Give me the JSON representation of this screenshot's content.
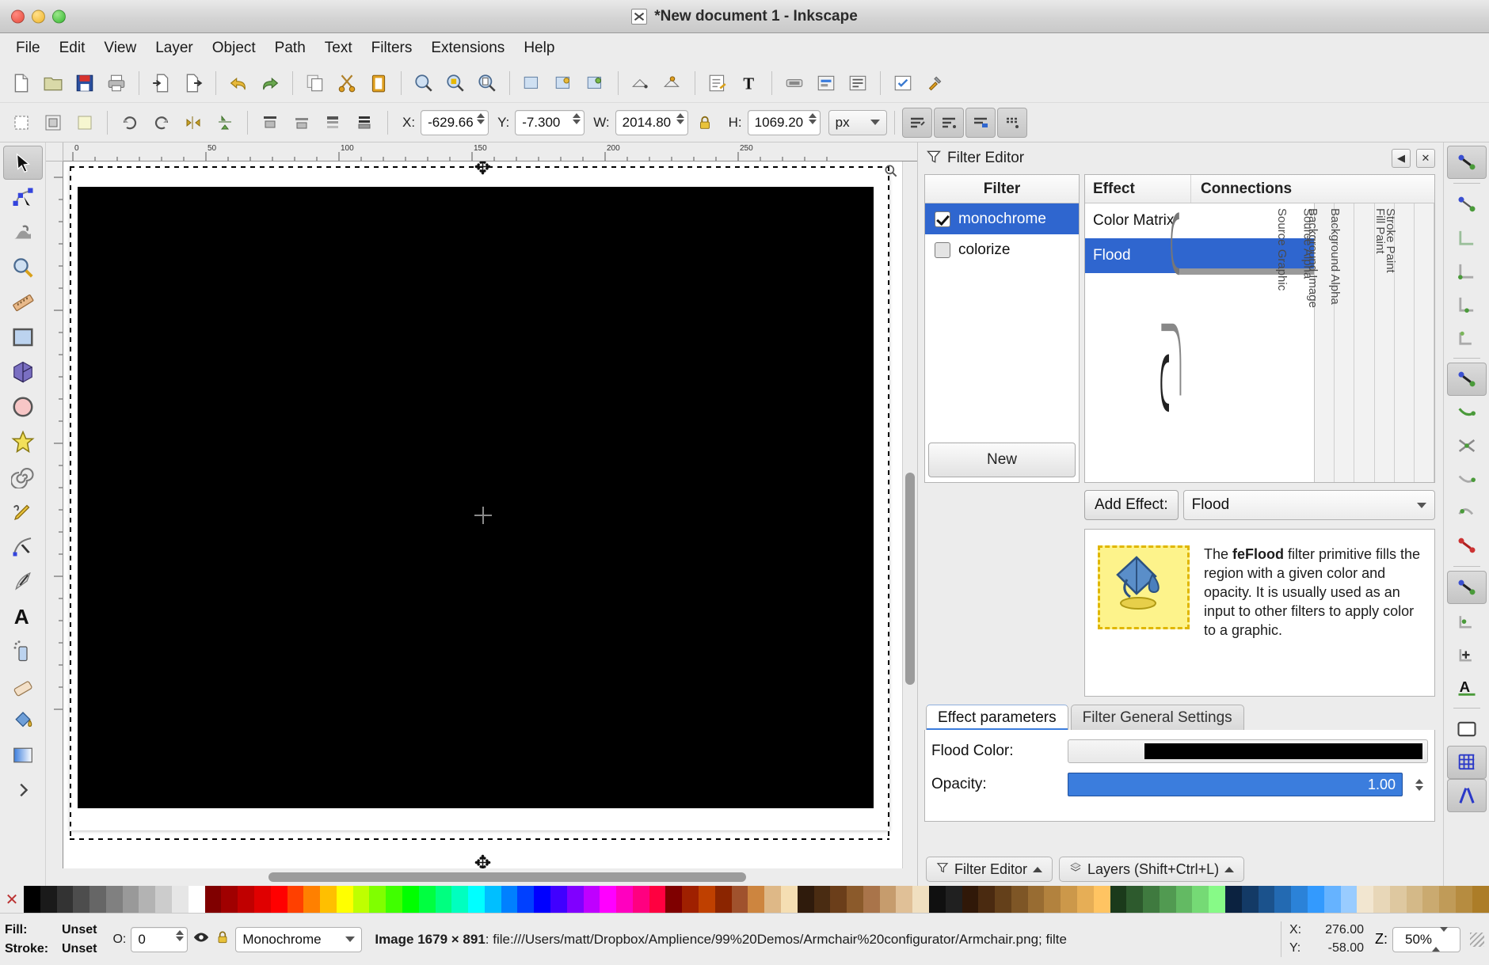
{
  "window": {
    "title": "*New document 1 - Inkscape",
    "app_icon": "x-window-icon"
  },
  "menubar": {
    "items": [
      "File",
      "Edit",
      "View",
      "Layer",
      "Object",
      "Path",
      "Text",
      "Filters",
      "Extensions",
      "Help"
    ]
  },
  "command_toolbar": {
    "icons": [
      "new-document-icon",
      "open-document-icon",
      "save-document-icon",
      "print-icon",
      "import-icon",
      "export-icon",
      "undo-icon",
      "redo-icon",
      "copy-icon",
      "cut-icon",
      "paste-icon",
      "zoom-selection-icon",
      "zoom-drawing-icon",
      "zoom-page-icon",
      "duplicate-icon",
      "clone-icon",
      "unlink-clone-icon",
      "group-icon",
      "ungroup-icon",
      "xml-editor-icon",
      "text-tool-icon",
      "fill-stroke-icon",
      "align-icon",
      "objects-icon",
      "preferences-icon",
      "document-properties-icon"
    ]
  },
  "tool_controls": {
    "select_all_icon": "select-all-icon",
    "deselect_icon": "deselect-icon",
    "rotate_ccw_icon": "rotate-ccw-icon",
    "rotate_cw_icon": "rotate-cw-icon",
    "flip_h_icon": "flip-horizontal-icon",
    "flip_v_icon": "flip-vertical-icon",
    "raise_top_icon": "raise-to-top-icon",
    "raise_icon": "raise-icon",
    "lower_icon": "lower-icon",
    "lower_bottom_icon": "lower-to-bottom-icon",
    "x_label": "X:",
    "x_value": "-629.66",
    "y_label": "Y:",
    "y_value": "-7.300",
    "w_label": "W:",
    "w_value": "2014.80",
    "lock_icon": "lock-ratio-icon",
    "h_label": "H:",
    "h_value": "1069.20",
    "unit_value": "px",
    "affect_icons": [
      "affect-stroke-width-icon",
      "affect-rounded-corners-icon",
      "affect-gradients-icon",
      "affect-patterns-icon"
    ]
  },
  "toolbox": {
    "tools": [
      {
        "name": "selector-tool",
        "icon": "arrow-cursor-icon",
        "selected": true
      },
      {
        "name": "node-tool",
        "icon": "node-editor-icon",
        "selected": false
      },
      {
        "name": "tweak-tool",
        "icon": "tweak-icon",
        "selected": false
      },
      {
        "name": "zoom-tool",
        "icon": "magnifier-icon",
        "selected": false
      },
      {
        "name": "measure-tool",
        "icon": "ruler-icon",
        "selected": false
      },
      {
        "name": "rectangle-tool",
        "icon": "rectangle-icon",
        "selected": false
      },
      {
        "name": "box3d-tool",
        "icon": "cube-icon",
        "selected": false
      },
      {
        "name": "ellipse-tool",
        "icon": "ellipse-icon",
        "selected": false
      },
      {
        "name": "star-tool",
        "icon": "star-icon",
        "selected": false
      },
      {
        "name": "spiral-tool",
        "icon": "spiral-icon",
        "selected": false
      },
      {
        "name": "pencil-tool",
        "icon": "pencil-icon",
        "selected": false
      },
      {
        "name": "bezier-tool",
        "icon": "bezier-pen-icon",
        "selected": false
      },
      {
        "name": "calligraphy-tool",
        "icon": "calligraphy-icon",
        "selected": false
      },
      {
        "name": "text-tool",
        "icon": "text-a-icon",
        "selected": false
      },
      {
        "name": "spray-tool",
        "icon": "spray-can-icon",
        "selected": false
      },
      {
        "name": "eraser-tool",
        "icon": "eraser-icon",
        "selected": false
      },
      {
        "name": "bucket-tool",
        "icon": "paint-bucket-icon",
        "selected": false
      },
      {
        "name": "gradient-tool",
        "icon": "gradient-icon",
        "selected": false
      },
      {
        "name": "more-tools",
        "icon": "chevron-right-icon",
        "selected": false
      }
    ]
  },
  "canvas": {
    "ruler_h_labels": [
      "0",
      "50",
      "100",
      "150",
      "200"
    ],
    "artwork_name": "black-image-object"
  },
  "filter_editor": {
    "panel_title": "Filter Editor",
    "minimize_icon": "minimize-icon",
    "close_icon": "close-icon",
    "filter_column_header": "Filter",
    "filters": [
      {
        "label": "monochrome",
        "checked": true,
        "selected": true
      },
      {
        "label": "colorize",
        "checked": false,
        "selected": false
      }
    ],
    "new_button": "New",
    "effect_column_header": "Effect",
    "connections_column_header": "Connections",
    "effects": [
      {
        "label": "Color Matrix",
        "selected": false
      },
      {
        "label": "Flood",
        "selected": true
      }
    ],
    "connection_columns": [
      "Source Graphic",
      "Source Alpha",
      "Background Image",
      "Background Alpha",
      "Fill Paint",
      "Stroke Paint"
    ],
    "add_effect_label": "Add Effect:",
    "add_effect_value": "Flood",
    "info_icon": "flood-bucket-icon",
    "info_text_prefix": "The ",
    "info_text_bold": "feFlood",
    "info_text_rest": " filter primitive fills the region with a given color and opacity.  It is usually used as an input to other filters to apply color to a graphic.",
    "tabs": [
      {
        "label": "Effect parameters",
        "active": true
      },
      {
        "label": "Filter General Settings",
        "active": false
      }
    ],
    "params": {
      "flood_color_label": "Flood Color:",
      "flood_color_value": "#000000",
      "opacity_label": "Opacity:",
      "opacity_value": "1.00"
    },
    "footer_buttons": [
      {
        "label": "Filter Editor",
        "icon": "filter-funnel-icon"
      },
      {
        "label": "Layers (Shift+Ctrl+L)",
        "icon": "layers-icon"
      }
    ]
  },
  "right_dock": {
    "tools": [
      {
        "name": "snap-enable",
        "icon": "snap-node-icon",
        "selected": true
      },
      {
        "name": "snap-bbox",
        "icon": "snap-bbox-icon",
        "selected": false
      },
      {
        "name": "snap-bbox-edge",
        "icon": "snap-bbox-edge-icon",
        "selected": false
      },
      {
        "name": "snap-bbox-corner",
        "icon": "snap-bbox-corner-icon",
        "selected": false
      },
      {
        "name": "snap-bbox-midpoint",
        "icon": "snap-bbox-midpoint-icon",
        "selected": false
      },
      {
        "name": "snap-bbox-center",
        "icon": "snap-bbox-center-icon",
        "selected": false
      },
      {
        "name": "snap-nodes",
        "icon": "snap-nodes-icon",
        "selected": true
      },
      {
        "name": "snap-path",
        "icon": "snap-path-icon",
        "selected": false
      },
      {
        "name": "snap-path-intersection",
        "icon": "snap-path-intersection-icon",
        "selected": false
      },
      {
        "name": "snap-cusp-node",
        "icon": "snap-cusp-icon",
        "selected": false
      },
      {
        "name": "snap-smooth-node",
        "icon": "snap-smooth-icon",
        "selected": false
      },
      {
        "name": "snap-midpoint",
        "icon": "snap-midpoint-icon",
        "selected": false
      },
      {
        "name": "snap-others",
        "icon": "snap-others-icon",
        "selected": true
      },
      {
        "name": "snap-object-center",
        "icon": "snap-object-center-icon",
        "selected": false
      },
      {
        "name": "snap-rotation-center",
        "icon": "snap-rotation-center-icon",
        "selected": false
      },
      {
        "name": "snap-text-baseline",
        "icon": "snap-text-baseline-icon",
        "selected": false
      },
      {
        "name": "snap-page-border",
        "icon": "snap-page-border-icon",
        "selected": false
      },
      {
        "name": "snap-grid",
        "icon": "snap-grid-icon",
        "selected": true
      },
      {
        "name": "snap-guide",
        "icon": "snap-guide-icon",
        "selected": true
      }
    ]
  },
  "status_bar": {
    "fill_label": "Fill:",
    "fill_value": "Unset",
    "stroke_label": "Stroke:",
    "stroke_value": "Unset",
    "opacity_label": "O:",
    "opacity_value": "0",
    "visibility_icon": "eye-icon",
    "lock_icon": "lock-icon",
    "layer_value": "Monochrome",
    "message_prefix": "Image",
    "message_size": "1679 × 891",
    "message_rest": ": file:///Users/matt/Dropbox/Amplience/99%20Demos/Armchair%20configurator/Armchair.png; filte",
    "x_label": "X:",
    "x_value": "276.00",
    "y_label": "Y:",
    "y_value": "-58.00",
    "zoom_label": "Z:",
    "zoom_value": "50%"
  },
  "palette": {
    "colors": [
      "#000000",
      "#1a1a1a",
      "#333333",
      "#4d4d4d",
      "#666666",
      "#808080",
      "#999999",
      "#b3b3b3",
      "#cccccc",
      "#e6e6e6",
      "#ffffff",
      "#800000",
      "#a00000",
      "#c00000",
      "#e00000",
      "#ff0000",
      "#ff4000",
      "#ff8000",
      "#ffbf00",
      "#ffff00",
      "#bfff00",
      "#80ff00",
      "#40ff00",
      "#00ff00",
      "#00ff40",
      "#00ff80",
      "#00ffbf",
      "#00ffff",
      "#00bfff",
      "#0080ff",
      "#0040ff",
      "#0000ff",
      "#4000ff",
      "#8000ff",
      "#bf00ff",
      "#ff00ff",
      "#ff00bf",
      "#ff0080",
      "#ff0040",
      "#7f0000",
      "#9f2000",
      "#bf4000",
      "#8b2500",
      "#a0522d",
      "#cd853f",
      "#deb887",
      "#f5deb3",
      "#2f1b0c",
      "#4a2c12",
      "#6b3e1a",
      "#8b5a2b",
      "#a9744a",
      "#c69c6d",
      "#e0c097",
      "#f0dfc0",
      "#101010",
      "#202020",
      "#301808",
      "#4a2a10",
      "#64401a",
      "#7e5626",
      "#986c32",
      "#b2823e",
      "#cc984a",
      "#e6ae56",
      "#ffc462",
      "#1b3a1b",
      "#2d5a2d",
      "#3f7a3f",
      "#519a51",
      "#63ba63",
      "#75da75",
      "#87fa87",
      "#0b2240",
      "#133a66",
      "#1b528c",
      "#236ab2",
      "#2b82d8",
      "#339afe",
      "#66b3ff",
      "#99ccff",
      "#f2e6d0",
      "#e8d7b8",
      "#dec8a0",
      "#d4b988",
      "#caaa70",
      "#c09b58",
      "#b68c40",
      "#ac7d28"
    ]
  }
}
